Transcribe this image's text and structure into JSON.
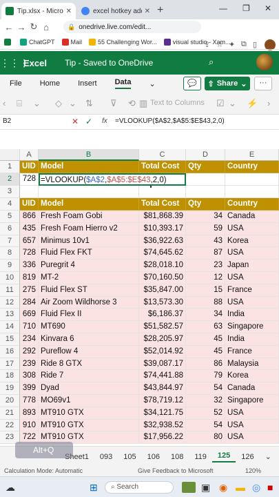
{
  "browser": {
    "tabs": [
      {
        "title": "Tip.xlsx - Microsoft Excel",
        "active": true
      },
      {
        "title": "excel hotkey add...",
        "active": false
      }
    ],
    "url": "onedrive.live.com/edit...",
    "bookmarks": [
      "ChatGPT",
      "Mail",
      "55 Challenging Wor...",
      "visual studio - Xam..."
    ]
  },
  "excel": {
    "app_name": "Excel",
    "doc_title": "Tip  -  Saved to OneDrive",
    "ribbon_tabs": [
      "File",
      "Home",
      "Insert",
      "Data"
    ],
    "selected_tab": "Data",
    "share_label": "Share",
    "text_to_columns": "Text to Columns",
    "name_box": "B2",
    "formula": "=VLOOKUP($A$2,$A$5:$E$43,2,0)"
  },
  "grid": {
    "columns": [
      "A",
      "B",
      "C",
      "D",
      "E"
    ],
    "lookup_header": [
      "UID",
      "Model",
      "Total Cost",
      "Qty",
      "Country"
    ],
    "lookup_row": {
      "uid": "728",
      "formula_prefix": "=VLOOKUP(",
      "ref1": "$A$2",
      "comma1": ",",
      "ref2": "$A$5:$E$43",
      "tail": ",2,0)"
    },
    "table_header": [
      "UID",
      "Model",
      "Total Cost",
      "Qty",
      "Country"
    ],
    "rows": [
      [
        "866",
        "Fresh Foam Gobi",
        "$81,868.39",
        "34",
        "Canada"
      ],
      [
        "435",
        "Fresh Foam Hierro v2",
        "$10,393.17",
        "59",
        "USA"
      ],
      [
        "657",
        "Minimus 10v1",
        "$36,922.63",
        "43",
        "Korea"
      ],
      [
        "728",
        "Fluid Flex FKT",
        "$74,645.62",
        "87",
        "USA"
      ],
      [
        "336",
        "Puregrit 4",
        "$28,018.10",
        "23",
        "Japan"
      ],
      [
        "819",
        "MT-2",
        "$70,160.50",
        "12",
        "USA"
      ],
      [
        "275",
        "Fluid Flex ST",
        "$35,847.00",
        "15",
        "France"
      ],
      [
        "284",
        "Air Zoom Wildhorse 3",
        "$13,573.30",
        "88",
        "USA"
      ],
      [
        "669",
        "Fluid Flex II",
        "$6,186.37",
        "34",
        "India"
      ],
      [
        "710",
        "MT690",
        "$51,582.57",
        "63",
        "Singapore"
      ],
      [
        "234",
        "Kinvara 6",
        "$28,205.97",
        "45",
        "India"
      ],
      [
        "292",
        "Pureflow 4",
        "$52,014.92",
        "45",
        "France"
      ],
      [
        "239",
        "Ride 8 GTX",
        "$39,087.17",
        "86",
        "Malaysia"
      ],
      [
        "308",
        "Ride 7",
        "$74,441.88",
        "79",
        "Korea"
      ],
      [
        "399",
        "Dyad",
        "$43,844.97",
        "54",
        "Canada"
      ],
      [
        "778",
        "MO69v1",
        "$78,719.12",
        "32",
        "Singapore"
      ],
      [
        "893",
        "MT910 GTX",
        "$34,121.75",
        "52",
        "USA"
      ],
      [
        "910",
        "MT910 GTX",
        "$32,938.52",
        "54",
        "USA"
      ],
      [
        "722",
        "MT910 GTX",
        "$17,956.22",
        "80",
        "USA"
      ]
    ]
  },
  "sheet_tabs": [
    "Sheet1",
    "093",
    "105",
    "106",
    "108",
    "119",
    "125",
    "126"
  ],
  "selected_sheet": "125",
  "overlay_hint": "Alt+Q",
  "status": {
    "calc_mode": "Calculation Mode: Automatic",
    "feedback": "Give Feedback to Microsoft",
    "zoom": "120%"
  },
  "taskbar": {
    "search_placeholder": "Search"
  },
  "colors": {
    "excel_green": "#107c41",
    "header_gold": "#bf9000",
    "row_pink": "#fbe3e4"
  }
}
